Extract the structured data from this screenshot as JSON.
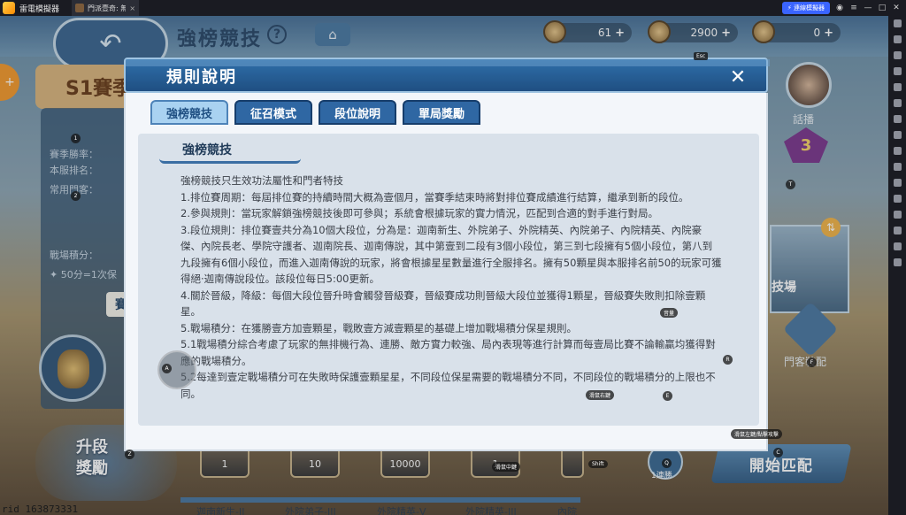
{
  "emulator": {
    "app_name": "雷電模擬器",
    "tab_label": "門派壹奇: 無...",
    "tab_close": "×",
    "sync_label": "⚡ 連線模擬器",
    "controls": [
      "◉",
      "≡",
      "—",
      "□",
      "✕"
    ]
  },
  "game_bg": {
    "title": "強榜競技",
    "help": "?",
    "home": "⌂",
    "back": "↶",
    "currencies": [
      {
        "value": "61"
      },
      {
        "value": "2900"
      },
      {
        "value": "0"
      }
    ],
    "plus": "+",
    "season": "S1賽季",
    "add": "+",
    "left_labels": [
      "賽季勝率：",
      "本服排名：",
      "常用門客："
    ],
    "score_label": "戰場積分：",
    "score_note": "✦ 50分=1次保",
    "left_btn": "賽",
    "rank_label": "話播",
    "rank_number": "3",
    "swap": "⇅",
    "arena_label": "技場",
    "equip_label": "門客裝配",
    "rank_up": [
      "升段",
      "獎勵"
    ],
    "rewards": [
      {
        "count": "1",
        "name": "迦南新生-II"
      },
      {
        "count": "10",
        "name": "外院弟子-III"
      },
      {
        "count": "10000",
        "name": "外院精英-V"
      },
      {
        "count": "1",
        "name": "外院精英-III"
      },
      {
        "count": "",
        "name": "內院"
      }
    ],
    "win_label": "1連勝",
    "start_label": "開始匹配",
    "uid": "rid 163873331"
  },
  "modal": {
    "title": "規則說明",
    "close": "✕",
    "esc": "Esc",
    "tabs": [
      "強榜競技",
      "征召模式",
      "段位說明",
      "單局獎勵"
    ],
    "active_tab": 0,
    "section_title": "強榜競技",
    "paragraphs": [
      "強榜競技只生效功法屬性和門者特技",
      "1.排位賽周期：每屆排位賽的持續時間大概為壹個月，當賽季結束時將對排位賽成績進行結算，繼承到新的段位。",
      "2.參與規則：當玩家解鎖強榜競技後即可參與；系統會根據玩家的實力情況，匹配到合適的對手進行對局。",
      "3.段位規則：排位賽壹共分為10個大段位，分為是：迦南新生、外院弟子、外院精英、內院弟子、內院精英、內院豪傑、內院長老、學院守護者、迦南院長、迦南傳說，其中第壹到二段有3個小段位，第三到七段擁有5個小段位，第八到九段擁有6個小段位，而進入迦南傳說的玩家，將會根據星星數量進行全服排名。擁有50顆星與本服排名前50的玩家可獲得絕·迦南傳說段位。該段位每日5:00更新。",
      "4.關於晉級，降級：每個大段位晉升時會觸發晉級賽，晉級賽成功則晉級大段位並獲得1顆星，晉級賽失敗則扣除壹顆星。",
      "5.戰場積分：在獲勝壹方加壹顆星，戰敗壹方減壹顆星的基礎上增加戰場積分保星規則。",
      "5.1戰場積分綜合考慮了玩家的無排機行為、連勝、敵方實力較強、局內表現等進行計算而每壹局比賽不論輸贏均獲得對應的戰場積分。",
      "5.2每達到壹定戰場積分可在失敗時保護壹顆星星，不同段位保星需要的戰場積分不同，不同段位的戰場積分的上限也不同。"
    ]
  },
  "key_hints": {
    "k1": "1",
    "k2": "2",
    "kT": "T",
    "kF": "F",
    "kR": "R",
    "kA": "A",
    "kE": "E",
    "kZ": "Z",
    "kC": "C",
    "kQ": "Q",
    "shift": "Shift",
    "p_middle": "滑鼠中鍵",
    "p_right": "滑鼠右鍵",
    "p_sound": "音量",
    "p_attack": "滑鼠左鍵/點擊攻擊",
    "p_bottom": "滑鼠中鍵"
  },
  "colors": {
    "modal_header": "#1f4f82",
    "tab_inactive": "#2f67a3",
    "tab_active": "#a9d2f1",
    "content_bg": "#d9e1ea",
    "accent": "#3a64ff"
  }
}
